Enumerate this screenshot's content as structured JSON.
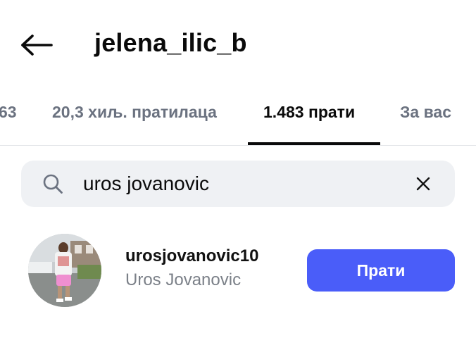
{
  "header": {
    "title": "jelena_ilic_b",
    "back_icon": "arrow-left-icon"
  },
  "tabs": [
    {
      "label": "63"
    },
    {
      "label": "20,3 хиљ. пратилаца"
    },
    {
      "label": "1.483 прати",
      "active": true
    },
    {
      "label": "За вас"
    }
  ],
  "search": {
    "value": "uros jovanovic",
    "icon": "search-icon",
    "clear_icon": "close-icon"
  },
  "results": [
    {
      "username": "urosjovanovic10",
      "full_name": "Uros Jovanovic",
      "button_label": "Прати",
      "avatar_icon": "avatar-photo"
    }
  ],
  "colors": {
    "accent": "#4a5df9",
    "search_bg": "#eff1f4",
    "secondary_text": "#7b8088"
  }
}
